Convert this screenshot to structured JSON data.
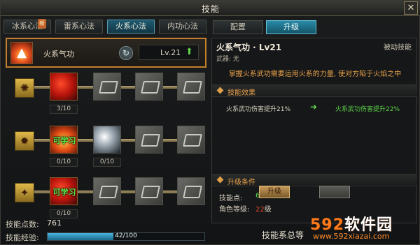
{
  "window": {
    "title": "技能",
    "close_glyph": "✕"
  },
  "left_tabs": [
    {
      "label": "冰系心法",
      "badge": "新"
    },
    {
      "label": "雷系心法"
    },
    {
      "label": "火系心法",
      "active": true
    },
    {
      "label": "内功心法"
    }
  ],
  "main_skill": {
    "name": "火系气功",
    "level": "Lv.21",
    "icon": "fire-icon"
  },
  "tree": {
    "row1": {
      "nodes": [
        {
          "label": "",
          "count": "3/10"
        }
      ]
    },
    "row2": {
      "nodes": [
        {
          "label": "可学习",
          "count": "0/10"
        },
        {
          "label": "",
          "count": "0/10"
        }
      ]
    },
    "row3": {
      "nodes": [
        {
          "label": "可学习",
          "count": "0/10"
        }
      ]
    }
  },
  "bottom": {
    "points_label": "技能点数:",
    "points_value": "761",
    "exp_label": "技能经验:",
    "exp_text": "42/100",
    "exp_fraction": 0.42
  },
  "right_tabs": [
    {
      "label": "配置"
    },
    {
      "label": "升级",
      "active": true
    }
  ],
  "detail": {
    "name": "火系气功 · Lv21",
    "passive": "被动技能",
    "weapon": "武器: 无",
    "description": "掌握火系武功需要运用火系的力量, 使对方陷于火焰之中",
    "effect_title": "技能效果",
    "effect_current": "火系武功伤害提升21%",
    "effect_next": "火系武功伤害提升22%",
    "req_title": "升级条件",
    "req_points_label": "技能点:",
    "req_points_value": "60",
    "req_level_label": "角色等级:",
    "req_level_value": "22",
    "req_level_unit": "级",
    "upgrade_label": "升级"
  },
  "footer": {
    "text": "技能系总等"
  },
  "watermark": {
    "logo_num": "592",
    "logo_text": "软件园",
    "url": "www.592xiazai.com"
  },
  "colors": {
    "accent_orange": "#c47e2c",
    "active_tab": "#1f5a70",
    "green": "#5fd34a",
    "desc_orange": "#e8a04a",
    "req_red": "#e04a2a"
  }
}
